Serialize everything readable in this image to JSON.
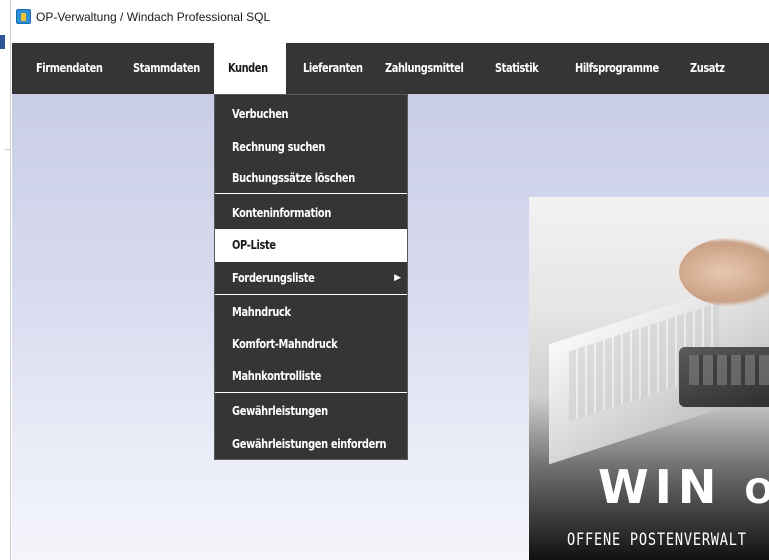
{
  "window": {
    "title": "OP-Verwaltung / Windach Professional SQL"
  },
  "menubar": {
    "items": [
      {
        "label": "Firmendaten"
      },
      {
        "label": "Stammdaten"
      },
      {
        "label": "Kunden",
        "active": true
      },
      {
        "label": "Lieferanten"
      },
      {
        "label": "Zahlungsmittel"
      },
      {
        "label": "Statistik"
      },
      {
        "label": "Hilfsprogramme"
      },
      {
        "label": "Zusatz"
      }
    ]
  },
  "dropdown": {
    "items": [
      {
        "label": "Verbuchen"
      },
      {
        "label": "Rechnung suchen"
      },
      {
        "label": "Buchungssätze löschen"
      },
      {
        "label": "Konteninformation"
      },
      {
        "label": "OP-Liste",
        "highlighted": true
      },
      {
        "label": "Forderungsliste",
        "has_submenu": true,
        "submenu_arrow": "▶"
      },
      {
        "label": "Mahndruck"
      },
      {
        "label": "Komfort-Mahndruck"
      },
      {
        "label": "Mahnkontrolliste"
      },
      {
        "label": "Gewährleistungen"
      },
      {
        "label": "Gewährleistungen einfordern"
      }
    ]
  },
  "banner": {
    "title_main": "WIN",
    "title_partial": "OPI",
    "subtitle": "OFFENE POSTENVERWALT"
  },
  "colors": {
    "menubar_bg": "#353535",
    "menu_text": "#ffffff",
    "active_bg": "#ffffff",
    "workspace_bg": "#d3d6ec"
  }
}
